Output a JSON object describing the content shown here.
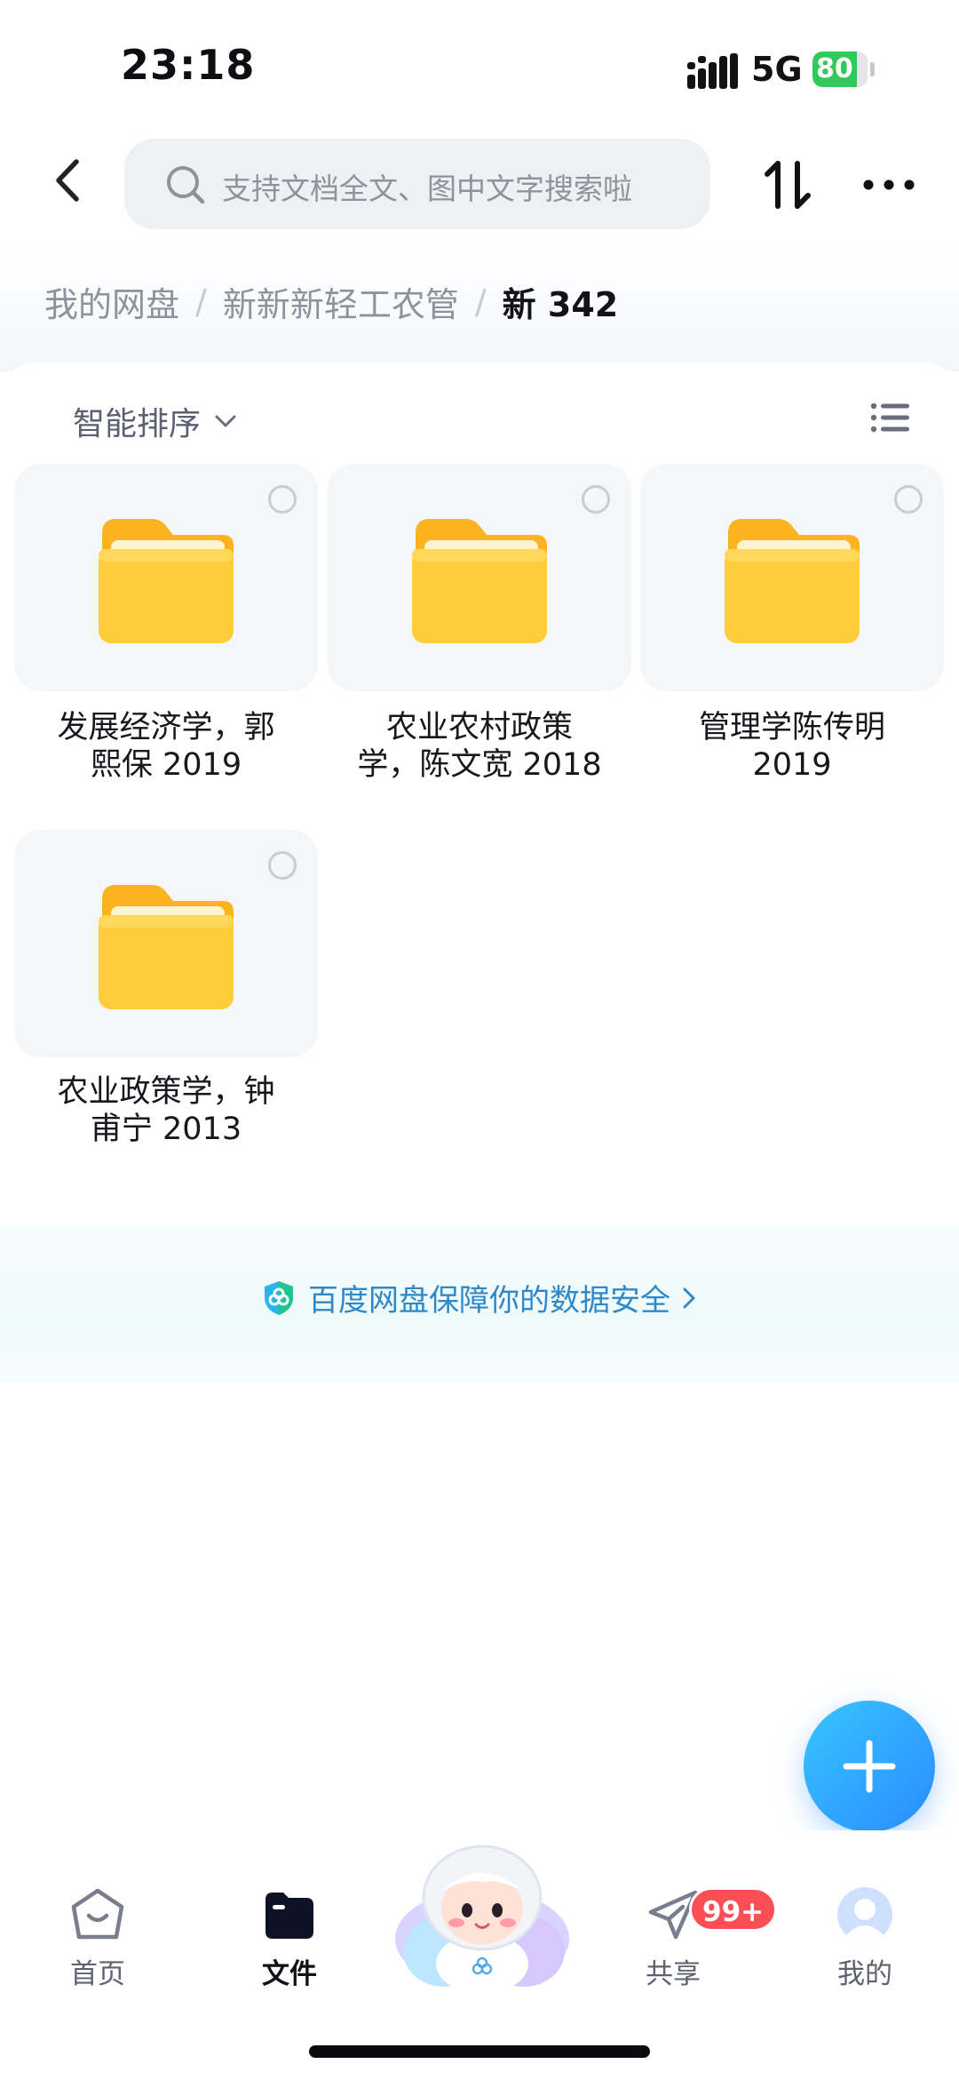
{
  "status_bar": {
    "time": "23:18",
    "network": "5G",
    "battery": "80",
    "battery_level": 0.8
  },
  "search": {
    "placeholder": "支持文档全文、图中文字搜索啦"
  },
  "breadcrumb": {
    "items": [
      "我的网盘",
      "新新新轻工农管"
    ],
    "current": "新 342",
    "separator": "/"
  },
  "toolbar": {
    "sort_label": "智能排序"
  },
  "folders": [
    {
      "line1": "发展经济学，郭",
      "line2": "熙保 2019"
    },
    {
      "line1": "农业农村政策",
      "line2": "学，陈文宽 2018"
    },
    {
      "line1": "管理学陈传明",
      "line2": "2019"
    },
    {
      "line1": "农业政策学，钟",
      "line2": "甫宁 2013"
    }
  ],
  "banner": {
    "text": "百度网盘保障你的数据安全"
  },
  "bottom_nav": {
    "items": [
      {
        "label": "首页",
        "icon": "home-icon"
      },
      {
        "label": "文件",
        "icon": "file-folder-icon",
        "active": true
      },
      {
        "label": "共享",
        "icon": "share-plane-icon"
      },
      {
        "label": "我的",
        "icon": "avatar-icon"
      }
    ],
    "share_badge": "99+"
  },
  "colors": {
    "accent": "#2a8bff",
    "folder": "#ffcb3d",
    "badge": "#fb4f55",
    "battery": "#34c759"
  }
}
